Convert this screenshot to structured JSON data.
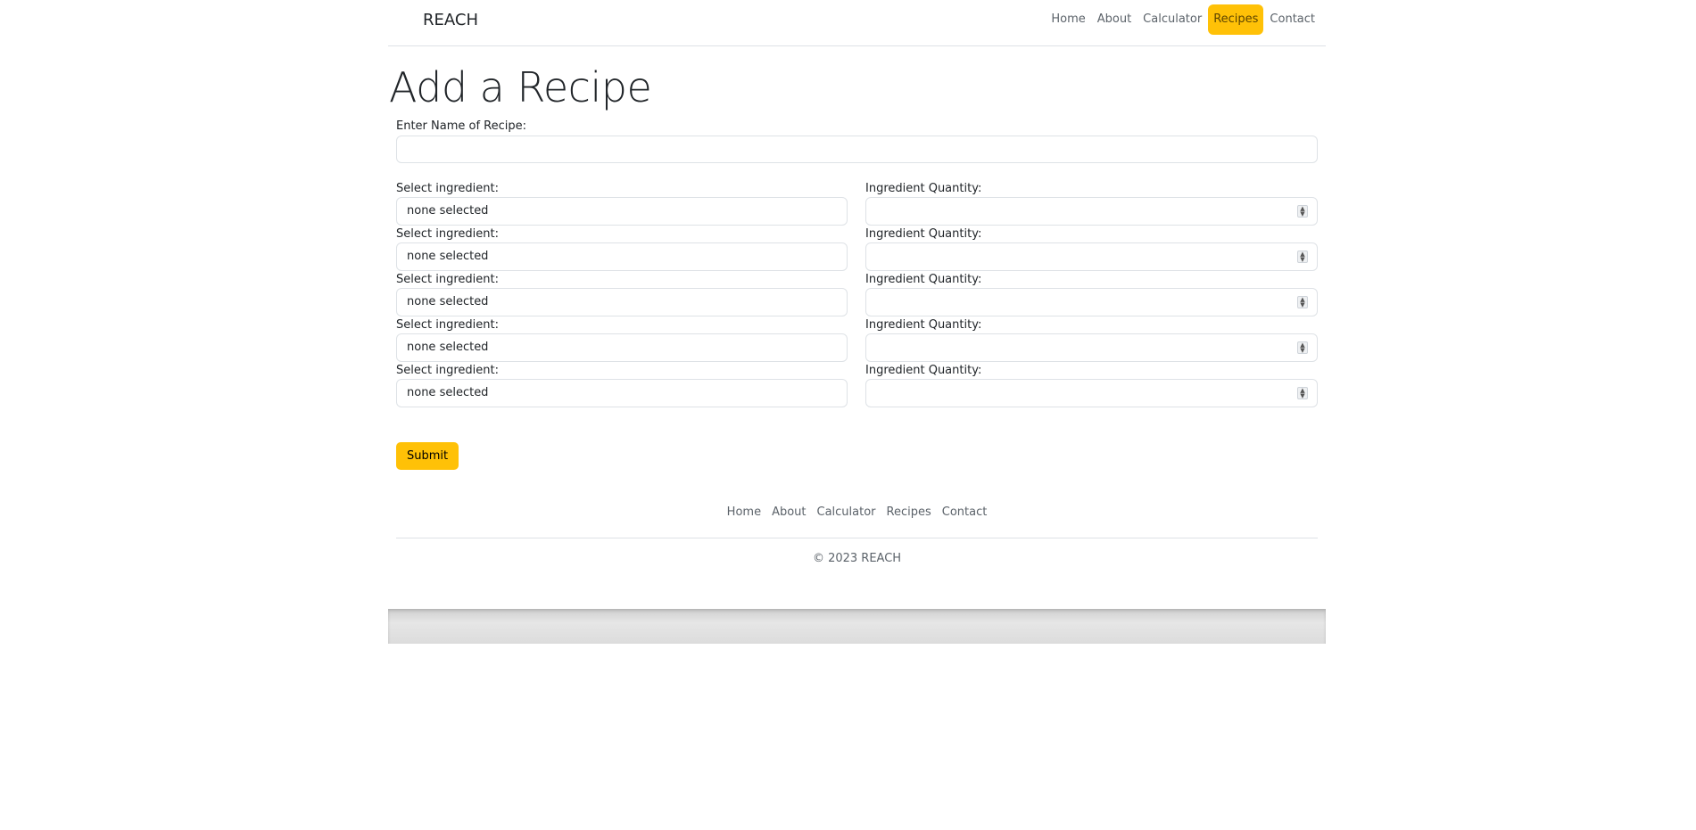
{
  "header": {
    "brand": "REACH",
    "nav": [
      {
        "label": "Home",
        "active": false
      },
      {
        "label": "About",
        "active": false
      },
      {
        "label": "Calculator",
        "active": false
      },
      {
        "label": "Recipes",
        "active": true
      },
      {
        "label": "Contact",
        "active": false
      }
    ]
  },
  "main": {
    "title": "Add a Recipe",
    "name_label": "Enter Name of Recipe:",
    "name_value": "",
    "ingredients": [
      {
        "select_label": "Select ingredient:",
        "select_value": "none selected",
        "qty_label": "Ingredient Quantity:",
        "qty_value": ""
      },
      {
        "select_label": "Select ingredient:",
        "select_value": "none selected",
        "qty_label": "Ingredient Quantity:",
        "qty_value": ""
      },
      {
        "select_label": "Select ingredient:",
        "select_value": "none selected",
        "qty_label": "Ingredient Quantity:",
        "qty_value": ""
      },
      {
        "select_label": "Select ingredient:",
        "select_value": "none selected",
        "qty_label": "Ingredient Quantity:",
        "qty_value": ""
      },
      {
        "select_label": "Select ingredient:",
        "select_value": "none selected",
        "qty_label": "Ingredient Quantity:",
        "qty_value": ""
      }
    ],
    "submit_label": "Submit"
  },
  "footer": {
    "nav": [
      "Home",
      "About",
      "Calculator",
      "Recipes",
      "Contact"
    ],
    "copyright": "© 2023 REACH"
  },
  "colors": {
    "accent": "#ffc107",
    "muted_text": "#5c636a",
    "border": "#dee2e6"
  }
}
